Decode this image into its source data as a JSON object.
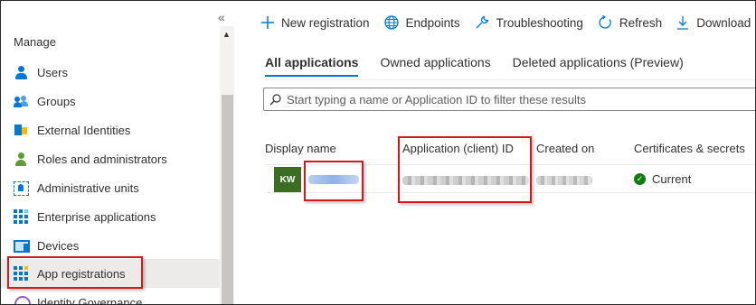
{
  "sidebar": {
    "collapse_glyph": "«",
    "section_title": "Manage",
    "items": [
      {
        "label": "Users",
        "icon": "user-icon"
      },
      {
        "label": "Groups",
        "icon": "groups-icon"
      },
      {
        "label": "External Identities",
        "icon": "external-identities-icon"
      },
      {
        "label": "Roles and administrators",
        "icon": "roles-icon"
      },
      {
        "label": "Administrative units",
        "icon": "admin-units-icon"
      },
      {
        "label": "Enterprise applications",
        "icon": "enterprise-apps-icon"
      },
      {
        "label": "Devices",
        "icon": "devices-icon"
      },
      {
        "label": "App registrations",
        "icon": "app-registrations-icon",
        "selected": true
      },
      {
        "label": "Identity Governance",
        "icon": "identity-governance-icon"
      }
    ]
  },
  "toolbar": {
    "new_registration": "New registration",
    "endpoints": "Endpoints",
    "troubleshooting": "Troubleshooting",
    "refresh": "Refresh",
    "download": "Download"
  },
  "tabs": [
    "All applications",
    "Owned applications",
    "Deleted applications (Preview)"
  ],
  "active_tab": "All applications",
  "filter": {
    "placeholder": "Start typing a name or Application ID to filter these results"
  },
  "table": {
    "columns": [
      "Display name",
      "Application (client) ID",
      "Created on",
      "Certificates & secrets"
    ],
    "rows": [
      {
        "avatar_initials": "KW",
        "certificates_status": "Current"
      }
    ]
  },
  "colors": {
    "accent": "#0078d4",
    "highlight_box": "#d21a1a",
    "avatar": "#3b6e22",
    "status_ok": "#107c10"
  }
}
